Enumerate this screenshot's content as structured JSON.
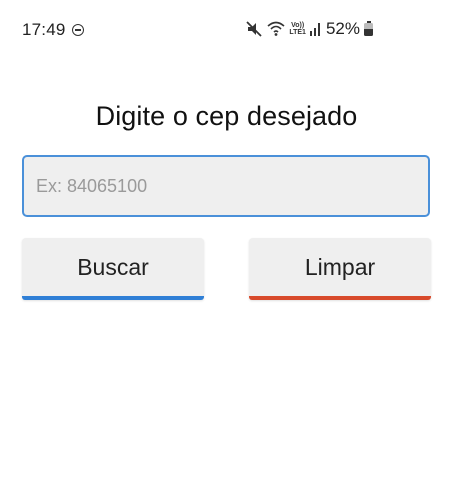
{
  "status_bar": {
    "time": "17:49",
    "battery": "52%",
    "volte_top": "Vo))",
    "volte_bottom": "LTE1",
    "icons": [
      "do-not-disturb-icon",
      "mute-icon",
      "wifi-icon",
      "volte-icon",
      "signal-icon",
      "battery-icon"
    ]
  },
  "main": {
    "title": "Digite o cep desejado",
    "cep_input": {
      "value": "",
      "placeholder": "Ex: 84065100"
    },
    "buttons": {
      "search_label": "Buscar",
      "clear_label": "Limpar"
    }
  },
  "colors": {
    "input_border": "#4a90d9",
    "search_accent": "#2f7fd6",
    "clear_accent": "#d84a2b",
    "button_bg": "#efefef"
  }
}
